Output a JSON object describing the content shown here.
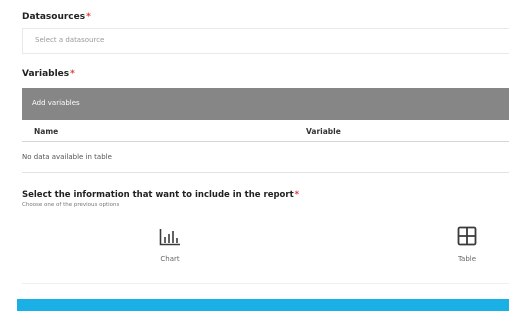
{
  "datasources": {
    "label": "Datasources",
    "required_mark": "*",
    "placeholder": "Select a datasource"
  },
  "variables": {
    "label": "Variables",
    "required_mark": "*",
    "add_button": "Add variables",
    "columns": [
      "Name",
      "Variable"
    ],
    "empty_message": "No data available in table"
  },
  "report": {
    "label": "Select the information that want to include in the report",
    "required_mark": "*",
    "hint": "Choose one of the previous options",
    "options": [
      {
        "label": "Chart",
        "icon": "bar-chart-icon"
      },
      {
        "label": "Table",
        "icon": "table-grid-icon"
      }
    ]
  },
  "colors": {
    "required": "#e23b3b",
    "add_bar": "#868686",
    "accent_bar": "#1ab0e6"
  }
}
